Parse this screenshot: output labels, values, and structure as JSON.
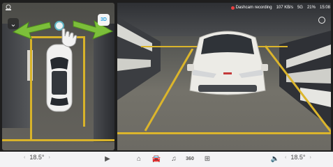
{
  "status_bar": {
    "recording_text": "Dashcam recording",
    "signal": "5G",
    "battery": "21%",
    "time": "15:08",
    "network_speed": "107 KB/s"
  },
  "bird_view": {
    "view_toggle_label": "3D",
    "collapse_icon": "chevron-down-icon"
  },
  "dock": {
    "temp_left": "18.5°",
    "temp_right": "18.5°",
    "view_360_label": "360",
    "icons": [
      "play-icon",
      "home-icon",
      "car-icon",
      "music-icon",
      "360-view-icon",
      "apps-icon",
      "volume-icon"
    ]
  },
  "colors": {
    "parking_line": "#d8b32a",
    "arrow_green": "#7cbf3a",
    "accent_blue": "#2aa2e0",
    "dock_bg": "#f3f3f5"
  }
}
